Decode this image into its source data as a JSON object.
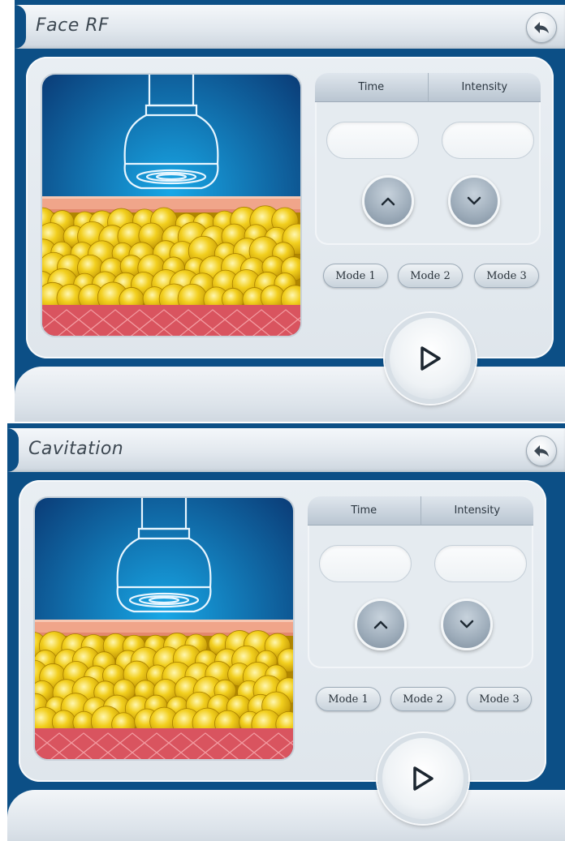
{
  "screens": [
    {
      "title": "Face RF",
      "tabs": [
        "Time",
        "Intensity"
      ],
      "modes": [
        "Mode 1",
        "Mode 2",
        "Mode 3"
      ],
      "icons": {
        "back": "back-arrow-icon",
        "up": "chevron-up-icon",
        "down": "chevron-down-icon",
        "play": "play-icon"
      }
    },
    {
      "title": "Cavitation",
      "tabs": [
        "Time",
        "Intensity"
      ],
      "modes": [
        "Mode 1",
        "Mode 2",
        "Mode 3"
      ],
      "icons": {
        "back": "back-arrow-icon",
        "up": "chevron-up-icon",
        "down": "chevron-down-icon",
        "play": "play-icon"
      }
    }
  ],
  "colors": {
    "background": "#0c4f86",
    "panel": "#e3e9ee",
    "fat": "#f2cf1e",
    "skin": "#f0a58a",
    "muscle": "#d9545f",
    "probe_glow": "#18a7e6"
  }
}
